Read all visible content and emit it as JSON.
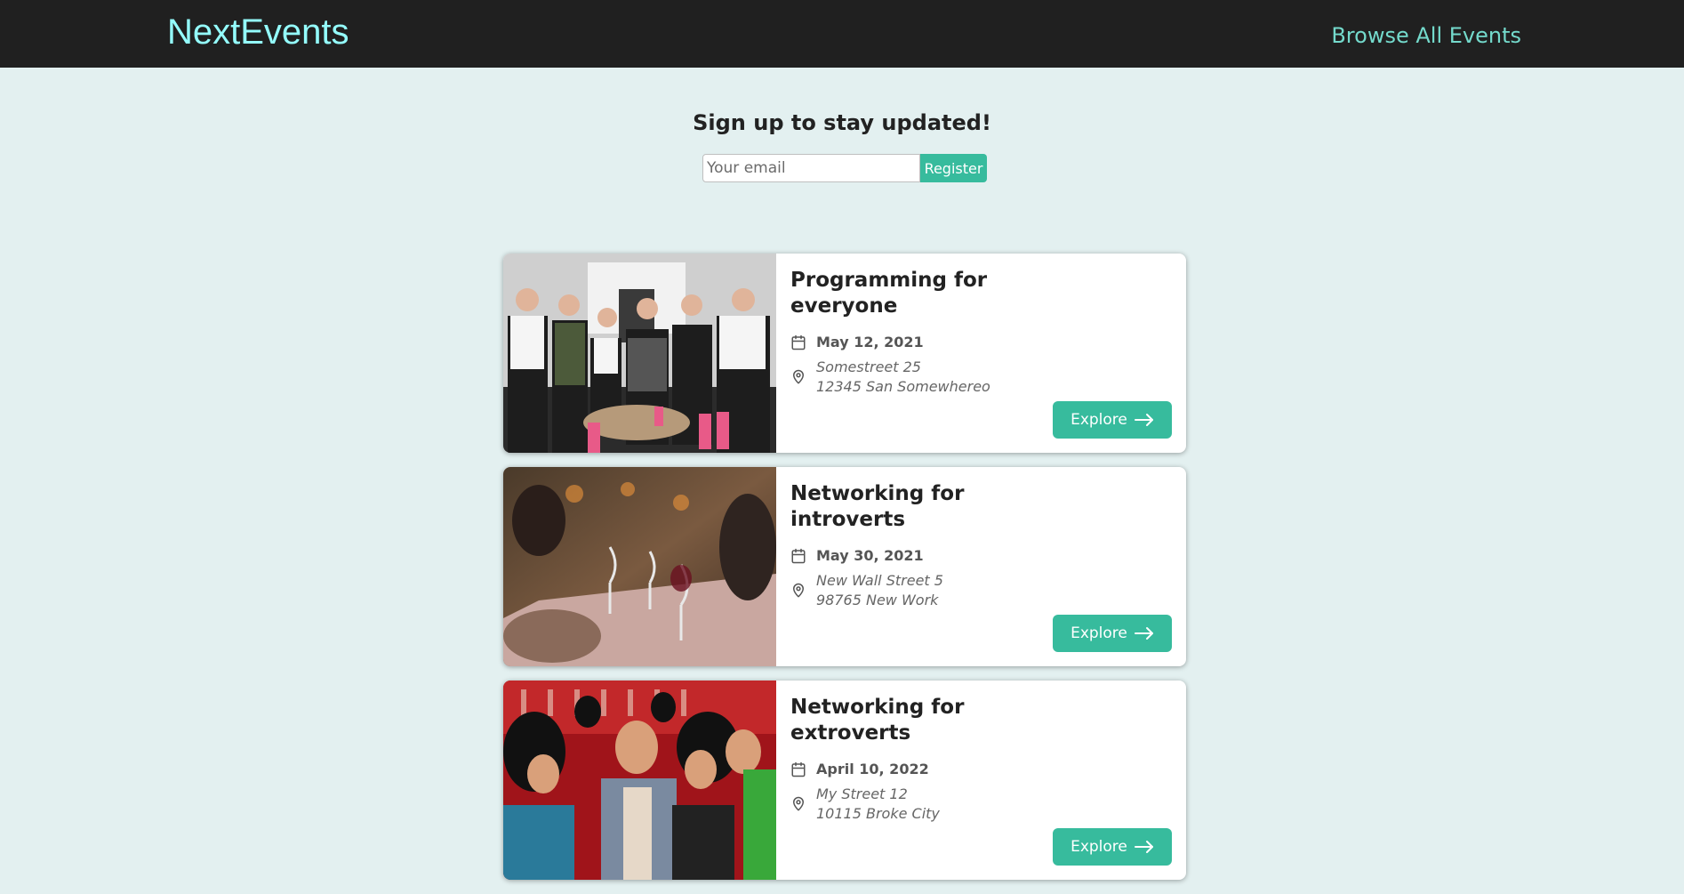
{
  "header": {
    "logo": "NextEvents",
    "browse_link": "Browse All Events"
  },
  "signup": {
    "title": "Sign up to stay updated!",
    "email_placeholder": "Your email",
    "register_label": "Register"
  },
  "events": [
    {
      "title": "Programming for everyone",
      "date": "May 12, 2021",
      "address_line1": "Somestreet 25",
      "address_line2": "12345 San Somewhereo",
      "explore_label": "Explore"
    },
    {
      "title": "Networking for introverts",
      "date": "May 30, 2021",
      "address_line1": "New Wall Street 5",
      "address_line2": "98765 New Work",
      "explore_label": "Explore"
    },
    {
      "title": "Networking for extroverts",
      "date": "April 10, 2022",
      "address_line1": "My Street 12",
      "address_line2": "10115 Broke City",
      "explore_label": "Explore"
    }
  ],
  "colors": {
    "header_bg": "#202020",
    "logo": "#94fdfd",
    "browse_link": "#74dacc",
    "page_bg": "#e3f0f0",
    "accent": "#37bb9d"
  },
  "icons": {
    "date": "calendar-icon",
    "address": "location-pin-icon",
    "explore": "arrow-right-icon"
  }
}
